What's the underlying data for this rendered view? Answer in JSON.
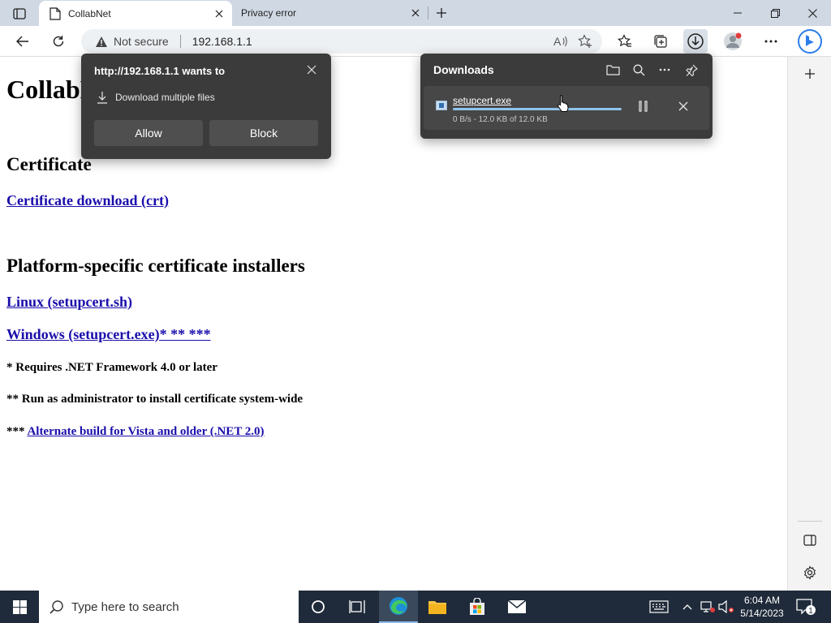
{
  "tabs": [
    {
      "title": "CollabNet",
      "active": true
    },
    {
      "title": "Privacy error",
      "active": false
    }
  ],
  "address": {
    "security_label": "Not secure",
    "url": "192.168.1.1"
  },
  "page": {
    "heading": "CollabNet",
    "section1": "Certificate",
    "link_crt": "Certificate download (crt)",
    "section2": "Platform-specific certificate installers",
    "link_linux": "Linux (setupcert.sh)",
    "link_windows": "Windows (setupcert.exe)* ** ***",
    "note1": "* Requires .NET Framework 4.0 or later",
    "note2": "** Run as administrator to install certificate system-wide",
    "note3_prefix": "*** ",
    "note3_link": "Alternate build for Vista and older (.NET 2.0)"
  },
  "permission_popup": {
    "title": "http://192.168.1.1 wants to",
    "request": "Download multiple files",
    "allow_label": "Allow",
    "block_label": "Block"
  },
  "downloads": {
    "title": "Downloads",
    "item": {
      "filename": "setupcert.exe",
      "status": "0 B/s - 12.0 KB of 12.0 KB",
      "progress": 1.0
    }
  },
  "taskbar": {
    "search_placeholder": "Type here to search",
    "time": "6:04 AM",
    "date": "5/14/2023",
    "notification_count": "1"
  },
  "colors": {
    "tabstrip": "#cfd8e3",
    "flyout_bg": "#3b3b3b",
    "link": "#1a0dab",
    "taskbar": "#1f2b3a",
    "progress_fill": "#8fc3ea"
  }
}
